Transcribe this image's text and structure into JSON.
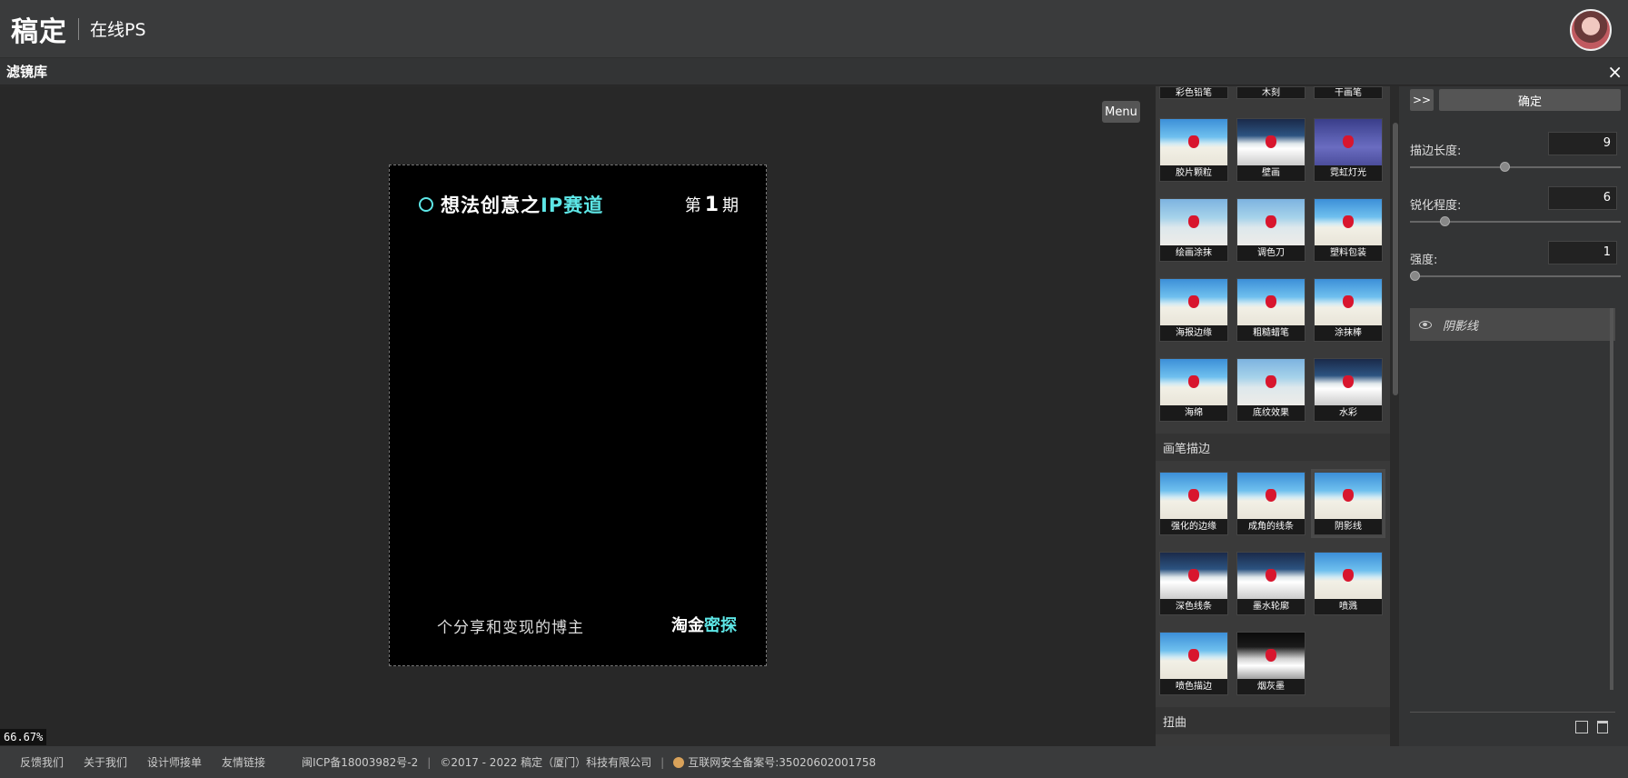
{
  "app": {
    "logo": "稿定",
    "name": "在线PS"
  },
  "panel": {
    "title": "滤镜库",
    "close": "×"
  },
  "canvas": {
    "menu_label": "Menu",
    "zoom": "66.67%",
    "doc": {
      "title_part1": "想法创意之",
      "title_part2": "IP赛道",
      "issue_prefix": "第",
      "issue_num": "1",
      "issue_suffix": "期",
      "subtitle": "个分享和变现的博主",
      "brand_part1": "淘金",
      "brand_part2": "密探"
    }
  },
  "filters": {
    "row_top_labels": [
      "彩色铅笔",
      "木刻",
      "干画笔"
    ],
    "artistic": [
      "胶片颗粒",
      "壁画",
      "霓虹灯光",
      "绘画涂抹",
      "调色刀",
      "塑料包装",
      "海报边缘",
      "粗糙蜡笔",
      "涂抹棒",
      "海绵",
      "底纹效果",
      "水彩"
    ],
    "section_brush": "画笔描边",
    "brush": [
      "强化的边缘",
      "成角的线条",
      "阴影线",
      "深色线条",
      "墨水轮廓",
      "喷溅",
      "喷色描边",
      "烟灰墨"
    ],
    "section_distort": "扭曲"
  },
  "settings": {
    "collapse_label": ">>",
    "ok_label": "确定",
    "params": [
      {
        "label": "描边长度:",
        "value": "9",
        "level": 0.45
      },
      {
        "label": "锐化程度:",
        "value": "6",
        "level": 0.15
      },
      {
        "label": "强度:",
        "value": "1",
        "level": 0.0
      }
    ],
    "layer": "阴影线"
  },
  "footer": {
    "links": [
      "反馈我们",
      "关于我们",
      "设计师接单",
      "友情链接"
    ],
    "icp": "闽ICP备18003982号-2",
    "copyright": "©2017 - 2022 稿定（厦门）科技有限公司",
    "security": "互联网安全备案号:35020602001758"
  }
}
